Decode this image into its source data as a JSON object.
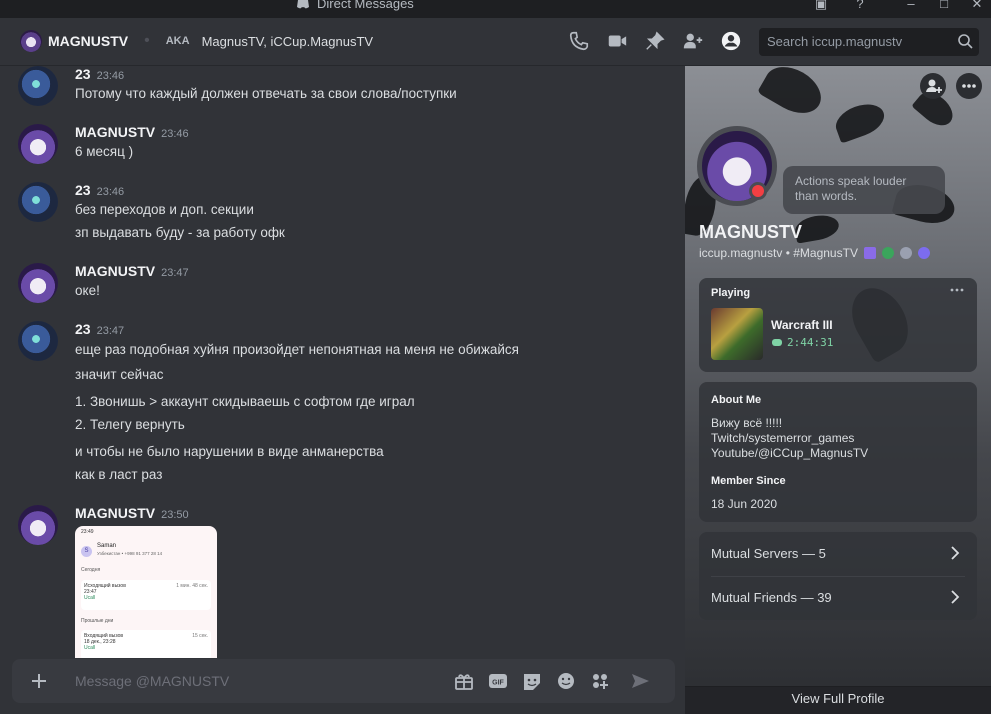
{
  "window": {
    "title": "Direct Messages"
  },
  "header": {
    "name": "MAGNUSTV",
    "aka_label": "AKA",
    "aka_values": "MagnusTV, iCCup.MagnusTV",
    "search_placeholder": "Search iccup.magnustv"
  },
  "messages": [
    {
      "user": "23",
      "time": "23:46",
      "lines": [
        "Потому что каждый должен отвечать за свои слова/поступки"
      ]
    },
    {
      "user": "MAGNUSTV",
      "time": "23:46",
      "lines": [
        "6 месяц )"
      ]
    },
    {
      "user": "23",
      "time": "23:46",
      "lines": [
        "без переходов и доп. секции",
        "зп выдавать буду - за работу офк"
      ]
    },
    {
      "user": "MAGNUSTV",
      "time": "23:47",
      "lines": [
        "оке!"
      ]
    },
    {
      "user": "23",
      "time": "23:47",
      "lines": [
        "еще раз подобная хуйня произойдет непонятная на меня не обижайся",
        "значит сейчас",
        "1. Звонишь > аккаунт скидываешь с софтом где играл",
        "2. Телегу вернуть",
        "и чтобы не было нарушении в виде анманерства",
        "как в ласт раз"
      ]
    },
    {
      "user": "MAGNUSTV",
      "time": "23:50",
      "lines": []
    }
  ],
  "attachment": {
    "time": "23:49",
    "contact": "Saman",
    "contact_sub": "Узбекистан • +998 91 377 28 14",
    "today_label": "Сегодня",
    "call1_title": "Исходящий вызов",
    "call1_time": "23:47",
    "call1_status": "Ucall",
    "call1_dur": "1 мин. 48 сек.",
    "past_label": "Прошлые дни",
    "call2_title": "Входящий вызов",
    "call2_time": "18 дек., 23:28",
    "call2_status": "Ucall",
    "call2_dur": "15 сек."
  },
  "composer": {
    "placeholder": "Message @MAGNUSTV",
    "gif_label": "GIF"
  },
  "profile": {
    "status_text": "Actions speak louder than words.",
    "display_name": "MAGNUSTV",
    "username_line": "iccup.magnustv • #MagnusTV",
    "playing_label": "Playing",
    "game_name": "Warcraft III",
    "game_time": "2:44:31",
    "about_label": "About Me",
    "about_lines": [
      "Вижу всё !!!!!",
      "Twitch/systemerror_games",
      "Youtube/@iCCup_MagnusTV"
    ],
    "member_since_label": "Member Since",
    "member_since_value": "18 Jun 2020",
    "mutual_servers": "Mutual Servers — 5",
    "mutual_friends": "Mutual Friends — 39",
    "view_full": "View Full Profile"
  },
  "colors": {
    "accent": "#5865f2",
    "online_green": "#23a55a",
    "dnd_red": "#f23f43",
    "game_time_green": "#7fd3a5"
  }
}
